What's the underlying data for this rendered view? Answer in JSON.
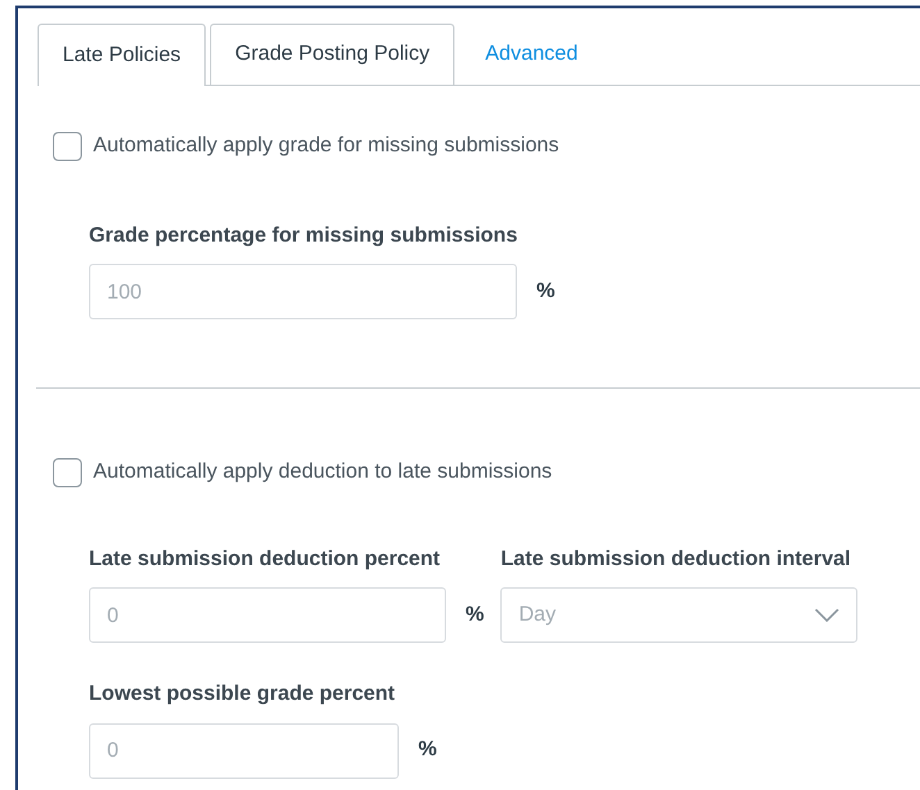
{
  "tabs": [
    {
      "label": "Late Policies",
      "selected": true,
      "kind": "tab"
    },
    {
      "label": "Grade Posting Policy",
      "selected": false,
      "kind": "tab"
    },
    {
      "label": "Advanced",
      "selected": false,
      "kind": "link"
    }
  ],
  "missing": {
    "checkbox": {
      "label": "Automatically apply grade for missing submissions",
      "checked": false
    },
    "field": {
      "label": "Grade percentage for missing submissions",
      "placeholder": "100",
      "unit": "%"
    }
  },
  "late": {
    "checkbox": {
      "label": "Automatically apply deduction to late submissions",
      "checked": false
    },
    "deduction": {
      "label": "Late submission deduction percent",
      "placeholder": "0",
      "unit": "%"
    },
    "interval": {
      "label": "Late submission deduction interval",
      "value": "Day",
      "disabled": true
    },
    "lowest": {
      "label": "Lowest possible grade percent",
      "placeholder": "0",
      "unit": "%"
    }
  }
}
